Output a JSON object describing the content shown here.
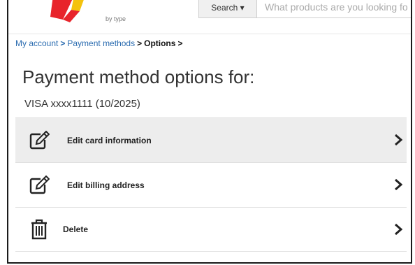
{
  "header": {
    "logo_subtitle": "by type",
    "search_button_label": "Search ▾",
    "search_placeholder": "What products are you looking fo"
  },
  "breadcrumb": {
    "items": [
      "My account",
      "Payment methods"
    ],
    "current": "Options"
  },
  "page": {
    "title": "Payment method options for:",
    "card": "VISA xxxx1111 (10/2025)"
  },
  "options": [
    {
      "label": "Edit card information",
      "icon": "edit-icon"
    },
    {
      "label": "Edit billing address",
      "icon": "edit-icon"
    },
    {
      "label": "Delete",
      "icon": "trash-icon"
    }
  ],
  "colors": {
    "link": "#2b6cb0",
    "active_row": "#ededed",
    "logo_red": "#e8242b",
    "logo_yellow": "#f4c20d"
  }
}
